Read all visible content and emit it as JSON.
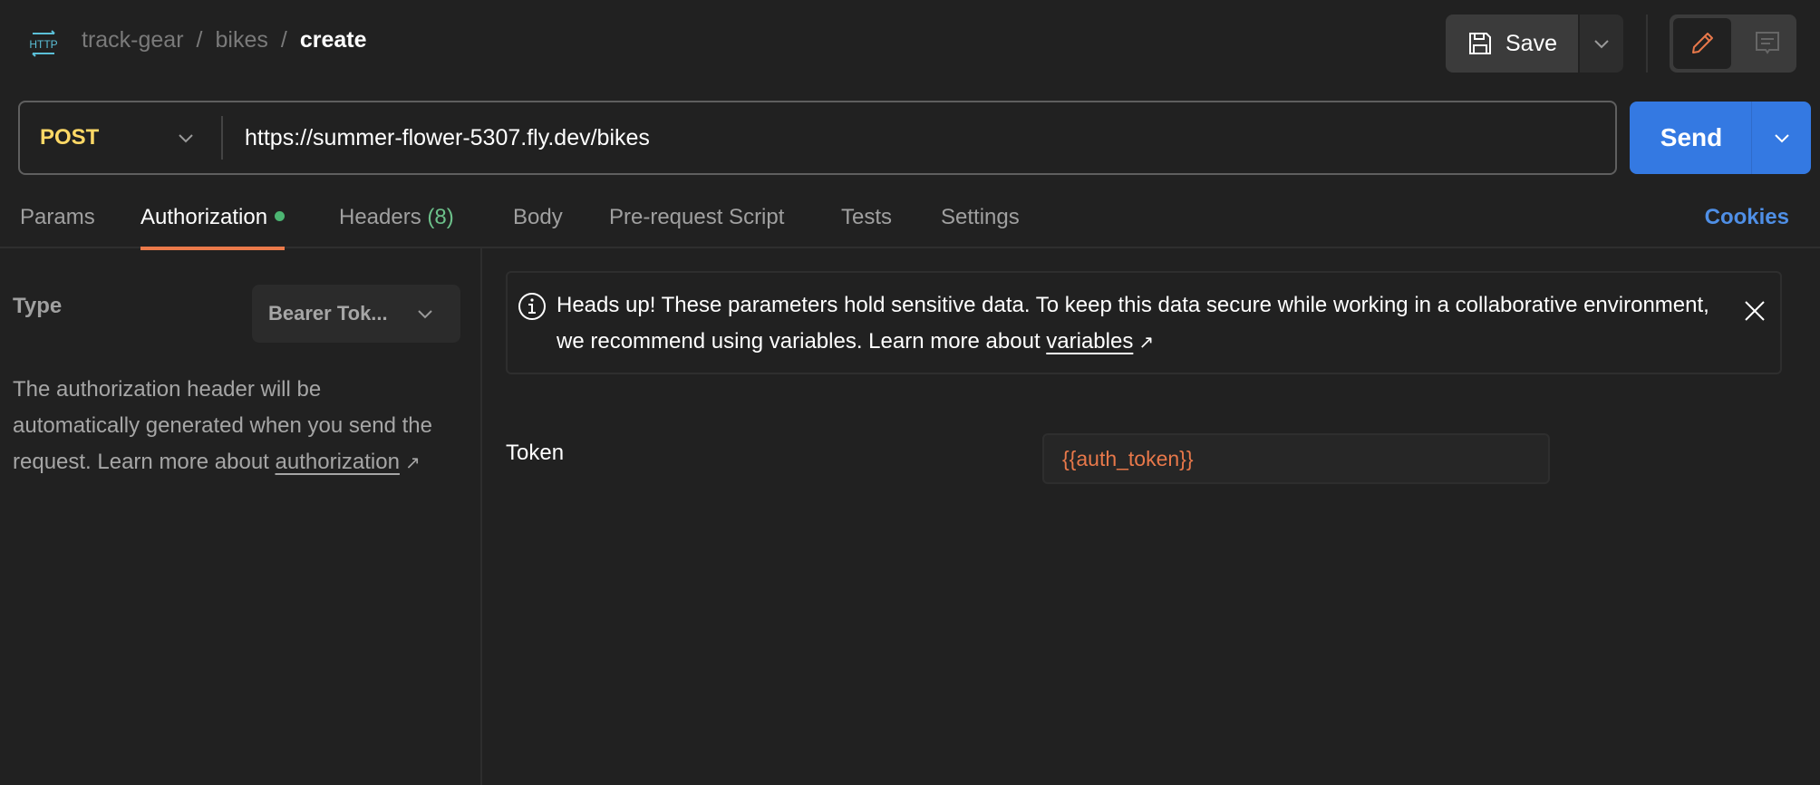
{
  "header": {
    "icon": "http-icon",
    "breadcrumb": [
      "track-gear",
      "bikes",
      "create"
    ],
    "separator": "/",
    "save_label": "Save"
  },
  "request": {
    "method": "POST",
    "url": "https://summer-flower-5307.fly.dev/bikes",
    "send_label": "Send"
  },
  "tabs": [
    {
      "label": "Params"
    },
    {
      "label": "Authorization",
      "active": true,
      "indicator": "green-dot"
    },
    {
      "label": "Headers",
      "count": "(8)"
    },
    {
      "label": "Body"
    },
    {
      "label": "Pre-request Script"
    },
    {
      "label": "Tests"
    },
    {
      "label": "Settings"
    }
  ],
  "cookies_label": "Cookies",
  "auth": {
    "type_label": "Type",
    "type_value": "Bearer Tok...",
    "description": "The authorization header will be automatically generated when you send the request. Learn more about ",
    "description_link": "authorization",
    "link_arrow": "↗"
  },
  "alert": {
    "text": "Heads up! These parameters hold sensitive data. To keep this data secure while working in a collaborative environment, we recommend using variables. Learn more about ",
    "link": "variables",
    "link_arrow": "↗"
  },
  "token": {
    "label": "Token",
    "value": "{{auth_token}}"
  },
  "colors": {
    "background": "#212121",
    "accent_orange": "#ec7a4a",
    "send_blue": "#3479e2",
    "method_yellow": "#ffd966",
    "status_green": "#4cb572",
    "link_blue": "#4f8fe6"
  }
}
